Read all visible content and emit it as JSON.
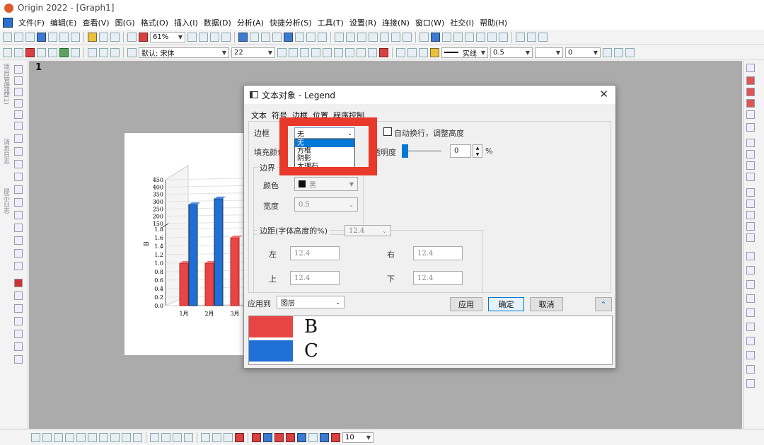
{
  "app": {
    "title": "Origin 2022 - [Graph1]"
  },
  "menu": [
    "文件(F)",
    "编辑(E)",
    "查看(V)",
    "图(G)",
    "格式(O)",
    "插入(I)",
    "数据(D)",
    "分析(A)",
    "快捷分析(S)",
    "工具(T)",
    "设置(R)",
    "连接(N)",
    "窗口(W)",
    "社交(I)",
    "帮助(H)"
  ],
  "toolbar": {
    "zoom": "61%",
    "font_label": "默认: 宋体",
    "font_size": "22",
    "line_style": "实线",
    "line_width": "0.5",
    "field_value": "0",
    "bottom_value": "10"
  },
  "left_tabs": [
    "项目管理器(1)",
    "消息日志",
    "提示日志"
  ],
  "graph": {
    "page_label": "1",
    "ylabel": "B",
    "y_ticks_low": [
      "0.0",
      "0.2",
      "0.4",
      "0.6",
      "0.8",
      "1.0",
      "1.2",
      "1.4",
      "1.6",
      "1.8"
    ],
    "y_ticks_high": [
      "150",
      "200",
      "250",
      "300",
      "350",
      "400",
      "450"
    ],
    "x_ticks": [
      "1月",
      "2月",
      "3月"
    ]
  },
  "chart_data": {
    "type": "bar",
    "categories": [
      "1月",
      "2月",
      "3月"
    ],
    "series": [
      {
        "name": "B",
        "values": [
          1.0,
          1.0,
          1.6
        ]
      },
      {
        "name": "C",
        "values": [
          280,
          320,
          null
        ]
      }
    ],
    "ylabel": "B"
  },
  "dialog": {
    "title": "文本对象 - Legend",
    "tabs": [
      "文本",
      "符号",
      "边框",
      "位置",
      "程序控制"
    ],
    "active_tab": "边框",
    "border_label": "边框",
    "border_value": "无",
    "border_options": [
      "无",
      "方框",
      "阴影",
      "大理石"
    ],
    "autowrap_label": "自动换行，调整高度",
    "fill_label": "填充颜色",
    "opacity_label": "透明度",
    "opacity_value": "0",
    "percent": "%",
    "edge_group": "边界",
    "color_label": "颜色",
    "color_value": "黑",
    "width_label": "宽度",
    "width_value": "0.5",
    "margin_group": "边距(字体高度的%)",
    "margin_value": "12.4",
    "left_label": "左",
    "left_value": "12.4",
    "right_label": "右",
    "right_value": "12.4",
    "top_label": "上",
    "top_value": "12.4",
    "bottom_label": "下",
    "bottom_value": "12.4",
    "apply_to_label": "应用到",
    "apply_to_value": "图层",
    "apply_btn": "应用",
    "ok_btn": "确定",
    "cancel_btn": "取消",
    "legend": [
      {
        "label": "B",
        "color": "#e84545"
      },
      {
        "label": "C",
        "color": "#1f6fd6"
      }
    ]
  }
}
